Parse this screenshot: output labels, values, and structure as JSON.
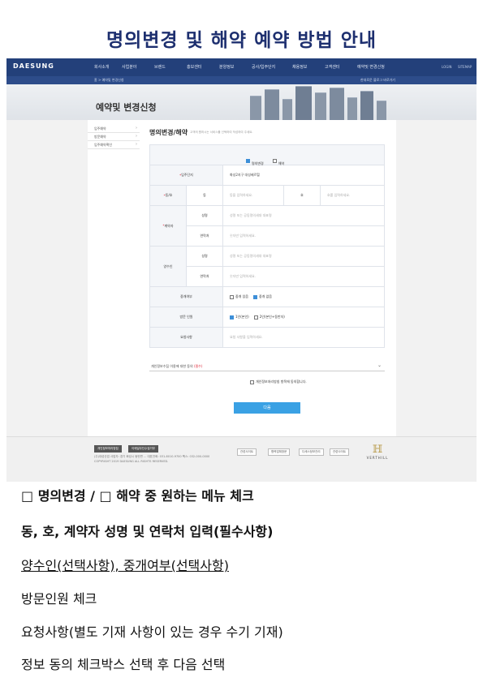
{
  "doc_title": "명의변경 및 해약 예약 방법 안내",
  "site": {
    "logo": "DAESUNG",
    "nav": [
      "회사소개",
      "사업분야",
      "브랜드",
      "홍보센터",
      "분양정보",
      "공사/입주단지",
      "채용정보",
      "고객센터",
      "예약및 변경신청"
    ],
    "util": [
      "LOGIN",
      "SITEMAP"
    ],
    "breadcrumb": "홈 > 예약및 변경신청",
    "breadcrumb_right": "한대로운 블로그 바로가기",
    "hero_title": "예약및 변경신청"
  },
  "left_menu": [
    "입주예약",
    "방문예약",
    "입주예약확인"
  ],
  "page_heading": "명의변경/해약",
  "page_sub": "고객의 원하시는 서비스를 선택하여 작성하여 주세요.",
  "form": {
    "choice_1": "명의변경",
    "choice_2": "해약",
    "complex_label": "입주단지",
    "complex_value": "화성2지구 대성베르힐",
    "dongho_label": "동/호",
    "dong_label": "동",
    "dong_placeholder": "동을 입력하세요.",
    "ho_label": "호",
    "ho_placeholder": "호를 입력하세요.",
    "contractor_label": "계약자",
    "name_label": "성명",
    "name_placeholder": "성명 또는 공동명의세대 대표명",
    "phone_label": "연락처",
    "phone_placeholder": "숫자만 입력하세요.",
    "transferee_label": "양수인",
    "t_name_label": "성명",
    "t_name_placeholder": "성명 또는 공동명의세대 대표명",
    "t_phone_label": "연락처",
    "t_phone_placeholder": "숫자만 입력하세요.",
    "broker_label": "중개여부",
    "broker_yes": "중개 있음",
    "broker_no": "중개 없음",
    "visitors_label": "방문 인원",
    "visitors_1": "1인(본인)",
    "visitors_2": "2인(본인+동반자)",
    "request_label": "요청사항",
    "request_placeholder": "요청 사항을 입력하세요.",
    "agree_text": "개인정보수집 이용에 대한 동의",
    "agree_required": "(필수)",
    "agree_check": "개인정보처리방침 항목에 동의합니다.",
    "submit": "다음"
  },
  "footer": {
    "btn1": "개인정보처리방침",
    "btn2": "이메일무단수집거부",
    "line1": "(주)대성산업   사업자: 경기 화성시 동탄면 ...   대표전화: 031-8010-9700   팩스: 032-000-0000",
    "line2": "COPYRIGHT 2019 DAESUNG ALL RIGHTS RESERVED.",
    "links": [
      "관련사이트",
      "협력업체방문",
      "다세스정보관리",
      "관련사이트"
    ],
    "vlogo": "VERTHILL"
  },
  "instructions": [
    "□ 명의변경 / □ 해약 중 원하는 메뉴 체크",
    "동, 호, 계약자 성명 및 연락처 입력(필수사항)",
    "양수인(선택사항), 중개여부(선택사항)",
    "방문인원 체크",
    "요청사항(별도 기재 사항이 있는 경우 수기 기재)",
    "정보 동의 체크박스 선택 후 다음 선택"
  ]
}
